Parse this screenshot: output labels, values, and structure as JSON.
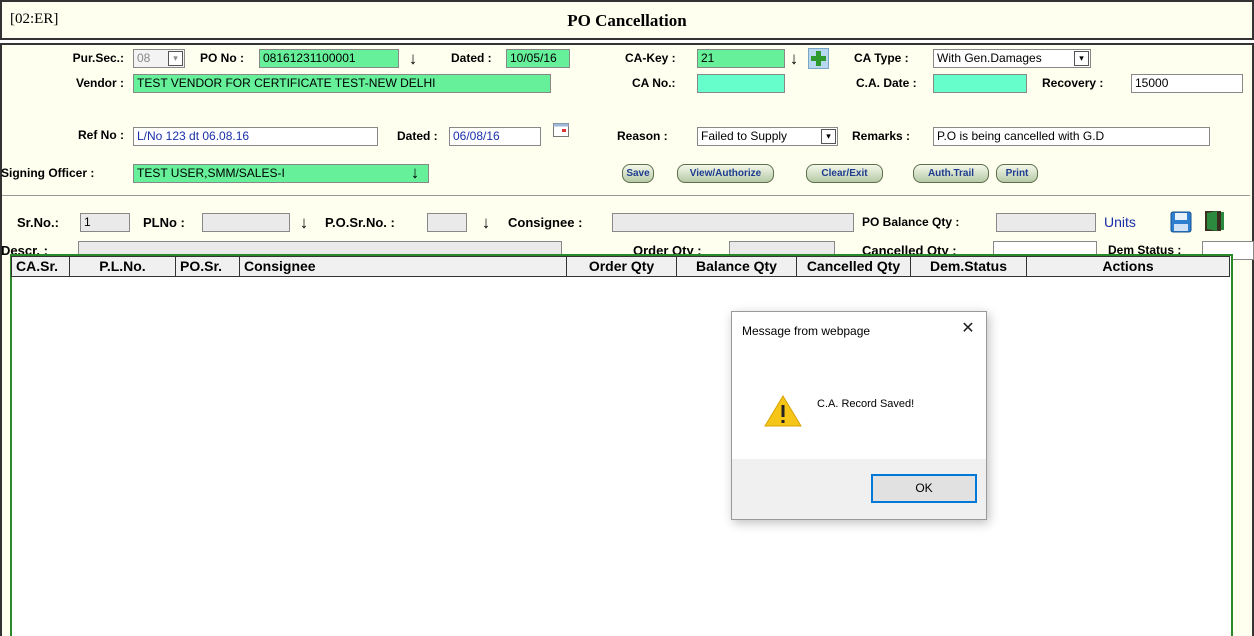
{
  "window": {
    "code": "[02:ER]",
    "title": "PO Cancellation"
  },
  "header_form": {
    "pur_sec_label": "Pur.Sec.:",
    "pur_sec_value": "08",
    "po_no_label": "PO No :",
    "po_no_value": "08161231100001",
    "dated_label": "Dated :",
    "dated_value": "10/05/16",
    "ca_key_label": "CA-Key :",
    "ca_key_value": "21",
    "ca_type_label": "CA Type :",
    "ca_type_value": "With Gen.Damages",
    "vendor_label": "Vendor :",
    "vendor_value": "TEST VENDOR FOR CERTIFICATE TEST-NEW DELHI",
    "ca_no_label": "CA No.:",
    "ca_no_value": "",
    "ca_date_label": "C.A. Date :",
    "ca_date_value": "",
    "recovery_label": "Recovery :",
    "recovery_value": "15000",
    "ref_no_label": "Ref No :",
    "ref_no_value": "L/No 123 dt 06.08.16",
    "ref_dated_label": "Dated :",
    "ref_dated_value": "06/08/16",
    "reason_label": "Reason :",
    "reason_value": "Failed to Supply",
    "remarks_label": "Remarks :",
    "remarks_value": "P.O is being cancelled with G.D",
    "signing_officer_label": "Signing Officer :",
    "signing_officer_value": "TEST USER,SMM/SALES-I"
  },
  "buttons": {
    "save": "Save",
    "view_authorize": "View/Authorize",
    "clear_exit": "Clear/Exit",
    "auth_trail": "Auth.Trail",
    "print": "Print"
  },
  "item_form": {
    "sr_no_label": "Sr.No.:",
    "sr_no_value": "1",
    "pl_no_label": "PLNo :",
    "pl_no_value": "",
    "po_sr_no_label": "P.O.Sr.No. :",
    "po_sr_no_value": "",
    "consignee_label": "Consignee :",
    "consignee_value": "",
    "po_balance_qty_label": "PO Balance Qty :",
    "po_balance_qty_value": "",
    "units_label": "Units",
    "descr_label": "Descr. :",
    "descr_value": "",
    "order_qty_label": "Order Qty :",
    "order_qty_value": "",
    "cancelled_qty_label": "Cancelled Qty :",
    "cancelled_qty_value": "",
    "dem_status_label": "Dem Status :",
    "dem_status_value": ""
  },
  "table": {
    "columns": [
      "CA.Sr.",
      "P.L.No.",
      "PO.Sr.",
      "Consignee",
      "Order Qty",
      "Balance Qty",
      "Cancelled Qty",
      "Dem.Status",
      "Actions"
    ],
    "rows": []
  },
  "dialog": {
    "title": "Message from webpage",
    "close": "✕",
    "message": "C.A. Record Saved!",
    "ok": "OK"
  },
  "icons": {
    "download": "↓",
    "add": "+",
    "save": "floppy",
    "exit": "door",
    "warning": "!",
    "calendar": "calendar"
  },
  "colors": {
    "form_bg": "#fffff0",
    "green_field": "#66f09a",
    "cyan_field": "#66ffcc",
    "grid_border": "#2a8a2a",
    "units_text": "#1a2fa8"
  }
}
